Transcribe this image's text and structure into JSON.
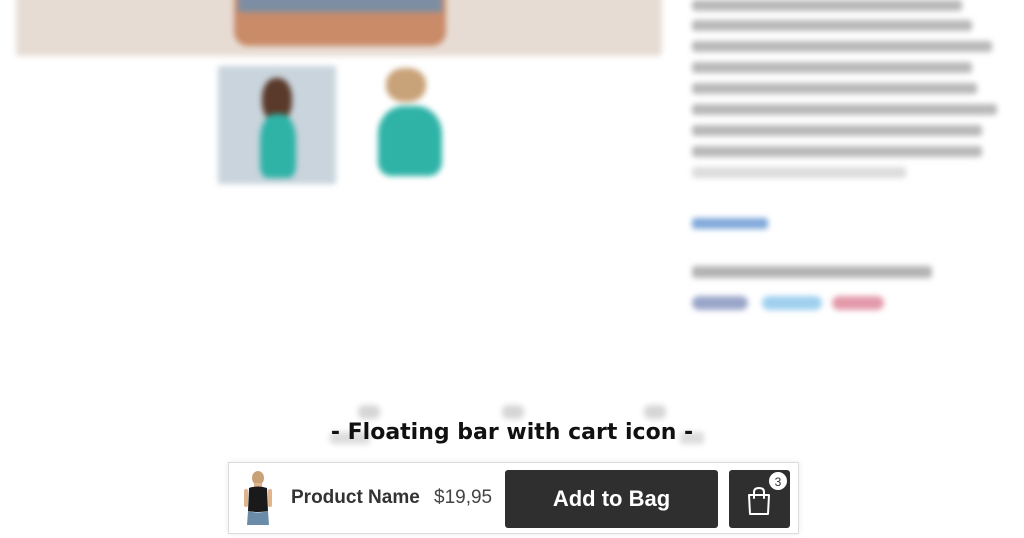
{
  "caption": "- Floating bar with cart icon -",
  "floating_bar": {
    "product_name": "Product Name",
    "price": "$19,95",
    "add_to_bag_label": "Add to Bag",
    "cart_count": "3"
  },
  "icons": {
    "cart": "shopping-bag-icon",
    "product_thumbnail": "product-thumbnail-image"
  },
  "colors": {
    "button_bg": "#2f2f2f",
    "button_text": "#ffffff",
    "bar_bg": "#ffffff",
    "caption_text": "#111111"
  }
}
